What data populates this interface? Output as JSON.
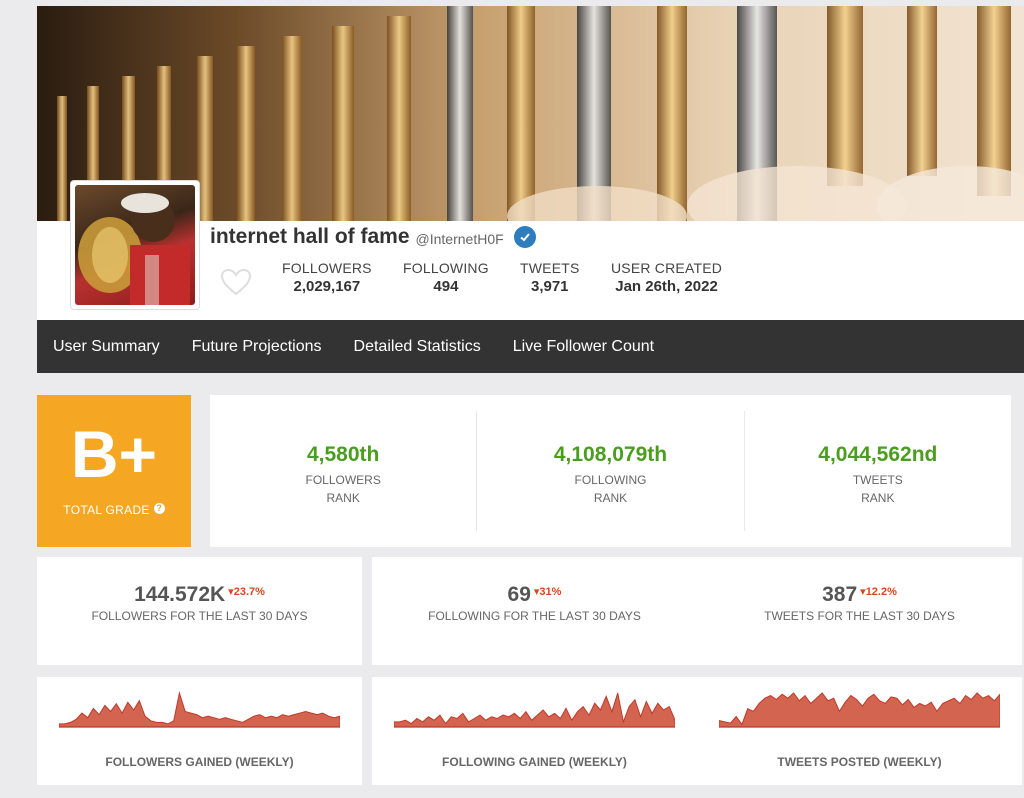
{
  "profile": {
    "name": "internet hall of fame",
    "handle": "@InternetH0F",
    "stats": [
      {
        "label": "FOLLOWERS",
        "value": "2,029,167"
      },
      {
        "label": "FOLLOWING",
        "value": "494"
      },
      {
        "label": "TWEETS",
        "value": "3,971"
      },
      {
        "label": "USER CREATED",
        "value": "Jan 26th, 2022"
      }
    ]
  },
  "nav": {
    "items": [
      "User Summary",
      "Future Projections",
      "Detailed Statistics",
      "Live Follower Count"
    ]
  },
  "grade": {
    "letter": "B+",
    "label": "TOTAL GRADE"
  },
  "ranks": [
    {
      "value": "4,580th",
      "line1": "FOLLOWERS",
      "line2": "RANK"
    },
    {
      "value": "4,108,079th",
      "line1": "FOLLOWING",
      "line2": "RANK"
    },
    {
      "value": "4,044,562nd",
      "line1": "TWEETS",
      "line2": "RANK"
    }
  ],
  "cards": [
    {
      "value": "144.572K",
      "change": "23.7%",
      "label": "FOLLOWERS FOR THE LAST 30 DAYS"
    },
    {
      "value": "69",
      "change": "31%",
      "label": "FOLLOWING FOR THE LAST 30 DAYS"
    },
    {
      "value": "387",
      "change": "12.2%",
      "label": "TWEETS FOR THE LAST 30 DAYS"
    }
  ],
  "sparks": [
    {
      "label": "FOLLOWERS GAINED (WEEKLY)",
      "values": [
        2,
        2,
        3,
        5,
        9,
        6,
        12,
        8,
        14,
        10,
        15,
        9,
        16,
        11,
        17,
        7,
        4,
        3,
        3,
        2,
        4,
        22,
        10,
        9,
        8,
        6,
        7,
        6,
        5,
        6,
        5,
        4,
        3,
        5,
        7,
        8,
        6,
        7,
        6,
        8,
        7,
        8,
        9,
        10,
        9,
        8,
        9,
        7,
        6,
        7
      ]
    },
    {
      "label": "FOLLOWING GAINED (WEEKLY)",
      "values": [
        3,
        3,
        4,
        2,
        5,
        3,
        6,
        4,
        7,
        2,
        6,
        5,
        8,
        3,
        5,
        7,
        4,
        6,
        5,
        7,
        6,
        8,
        5,
        9,
        4,
        7,
        10,
        6,
        8,
        5,
        11,
        4,
        9,
        12,
        7,
        14,
        10,
        18,
        9,
        20,
        3,
        12,
        16,
        6,
        15,
        8,
        14,
        10,
        12,
        4
      ]
    },
    {
      "label": "TWEETS POSTED (WEEKLY)",
      "values": [
        5,
        4,
        3,
        8,
        2,
        14,
        12,
        18,
        22,
        24,
        21,
        25,
        22,
        26,
        20,
        24,
        18,
        22,
        26,
        20,
        22,
        12,
        19,
        24,
        21,
        16,
        22,
        25,
        20,
        18,
        23,
        22,
        17,
        21,
        15,
        18,
        16,
        19,
        12,
        18,
        20,
        22,
        18,
        24,
        21,
        26,
        22,
        24,
        20,
        25
      ]
    }
  ],
  "colors": {
    "grade_bg": "#f5a623",
    "rank_green": "#4a9e1e",
    "change_red": "#d9451d",
    "spark_fill": "#d26450",
    "spark_stroke": "#c0392b",
    "nav_bg": "#333333",
    "verified": "#2e7dbe"
  }
}
